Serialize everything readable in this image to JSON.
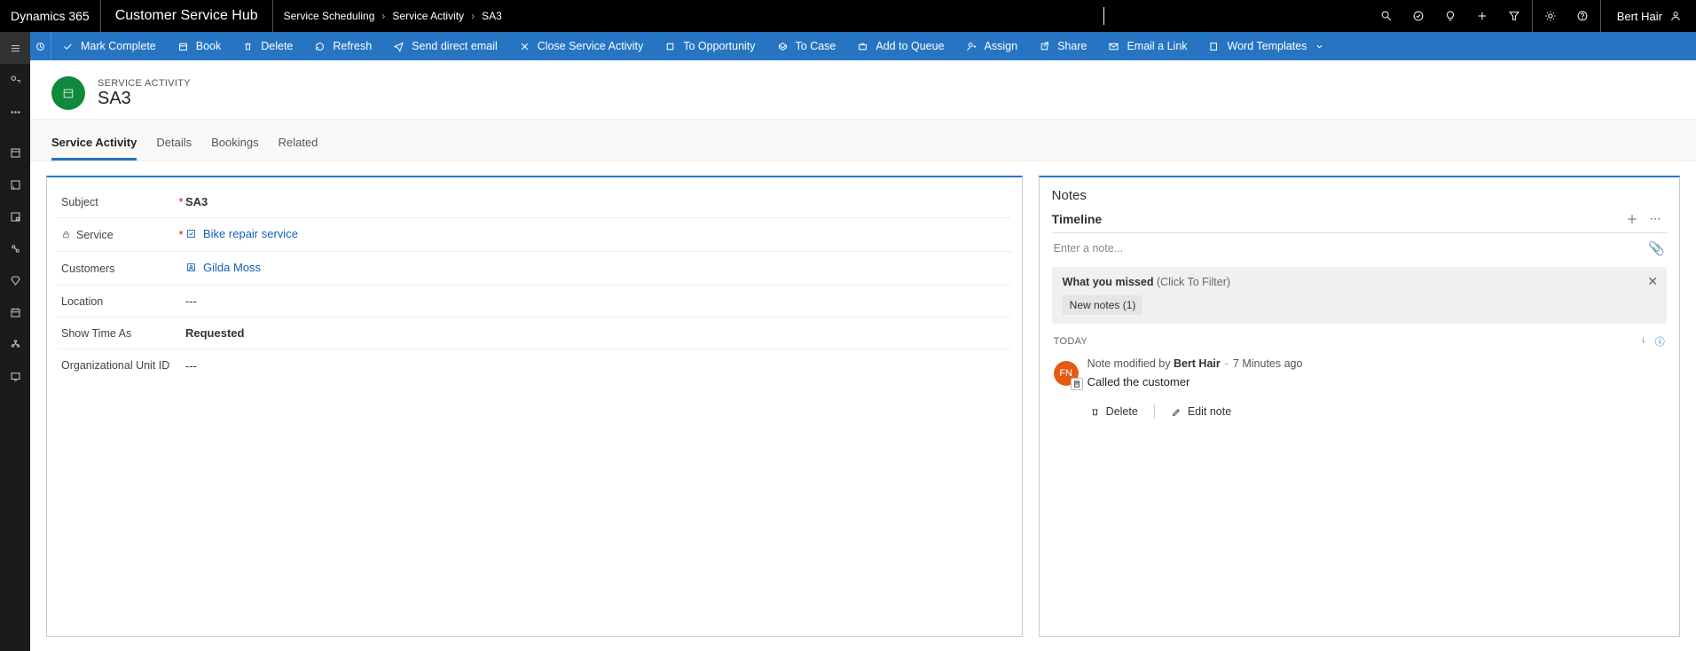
{
  "topbar": {
    "brand": "Dynamics 365",
    "hub": "Customer Service Hub",
    "crumbs": [
      "Service Scheduling",
      "Service Activity",
      "SA3"
    ],
    "user": "Bert Hair"
  },
  "commands": {
    "mark_complete": "Mark Complete",
    "book": "Book",
    "delete": "Delete",
    "refresh": "Refresh",
    "send_email": "Send direct email",
    "close_sa": "Close Service Activity",
    "to_opportunity": "To Opportunity",
    "to_case": "To Case",
    "add_queue": "Add to Queue",
    "assign": "Assign",
    "share": "Share",
    "email_link": "Email a Link",
    "word_templates": "Word Templates"
  },
  "page": {
    "type": "SERVICE ACTIVITY",
    "title": "SA3"
  },
  "tabs": [
    "Service Activity",
    "Details",
    "Bookings",
    "Related"
  ],
  "form": {
    "subject_label": "Subject",
    "subject": "SA3",
    "service_label": "Service",
    "service": "Bike repair service",
    "customers_label": "Customers",
    "customers": "Gilda Moss",
    "location_label": "Location",
    "location": "---",
    "showtime_label": "Show Time As",
    "showtime": "Requested",
    "orgunit_label": "Organizational Unit ID",
    "orgunit": "---"
  },
  "notes": {
    "panel_title": "Notes",
    "timeline_label": "Timeline",
    "placeholder": "Enter a note...",
    "missed_title": "What you missed",
    "missed_filter": "(Click To Filter)",
    "missed_chip": "New notes (1)",
    "today": "TODAY",
    "entry_prefix": "Note modified by ",
    "entry_user": "Bert Hair",
    "entry_time": "7 Minutes ago",
    "entry_body": "Called the customer",
    "delete": "Delete",
    "edit": "Edit note",
    "avatar_initials": "FN"
  }
}
